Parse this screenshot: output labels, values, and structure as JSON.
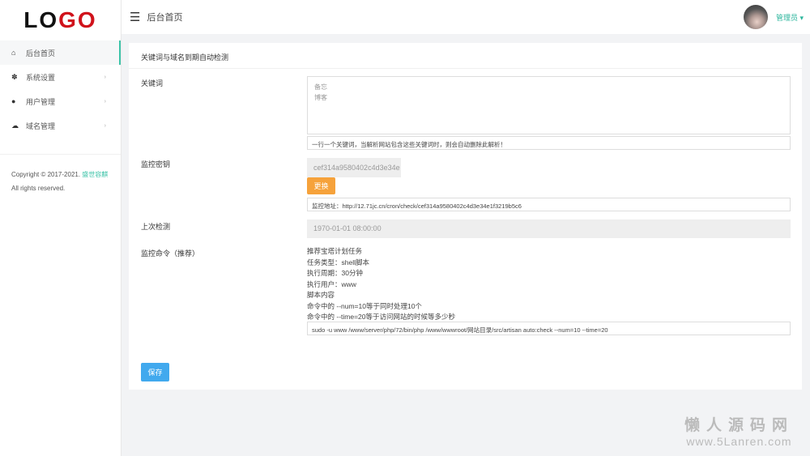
{
  "logo": {
    "part1": "LO",
    "part2": "GO"
  },
  "sidebar": {
    "items": [
      {
        "label": "后台首页",
        "icon": "home-icon",
        "active": true
      },
      {
        "label": "系统设置",
        "icon": "palette-icon",
        "arrow": "›"
      },
      {
        "label": "用户管理",
        "icon": "user-icon",
        "arrow": "›"
      },
      {
        "label": "域名管理",
        "icon": "cloud-icon",
        "arrow": "›"
      }
    ],
    "copyright": "Copyright © 2017-2021.",
    "company": "盛世容麒",
    "rights": "All rights reserved."
  },
  "header": {
    "title": "后台首页",
    "user": "管理员 ▾"
  },
  "card": {
    "title": "关键词与域名到期自动检测",
    "keywords": {
      "label": "关键词",
      "value": "备忘\n博客",
      "hint": "一行一个关键词，当解析网站包含这些关键词时，则会自动删除此解析！"
    },
    "key": {
      "label": "监控密钥",
      "value": "cef314a9580402c4d3e34e",
      "change_btn": "更换",
      "url": "监控地址：http://12.71jc.cn/cron/check/cef314a9580402c4d3e34e1f3219b5c6"
    },
    "last": {
      "label": "上次检测",
      "value": "1970-01-01 08:00:00"
    },
    "command": {
      "label": "监控命令（推荐）",
      "lines": [
        "推荐宝塔计划任务",
        "任务类型：shell脚本",
        "执行周期：30分钟",
        "执行用户：www",
        "脚本内容",
        "命令中的 --num=10等于同时处理10个",
        "命令中的 --time=20等于访问网站的时候等多少秒"
      ],
      "value": "sudo -u www /www/server/php/72/bin/php /www/wwwroot/网站目录/src/artisan auto:check --num=10 --time=20"
    },
    "save": "保存"
  },
  "watermark": {
    "line1": "懒人源码网",
    "line2": "www.5Lanren.com"
  }
}
